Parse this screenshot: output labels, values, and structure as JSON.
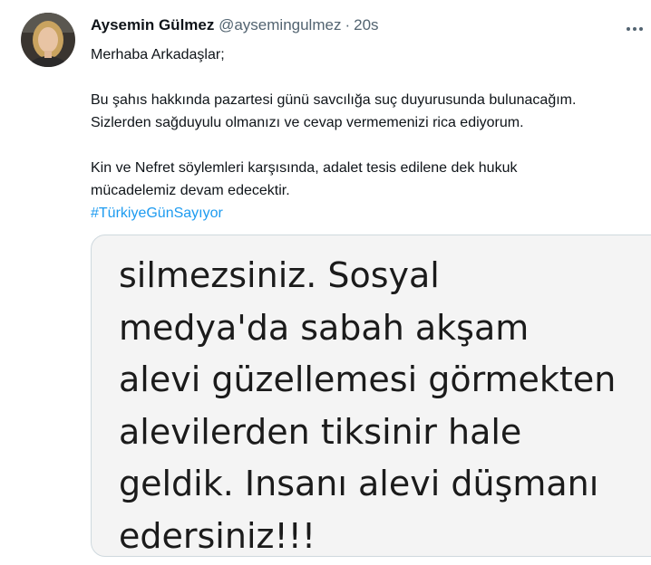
{
  "tweet": {
    "author_name": "Aysemin Gülmez",
    "handle": "@aysemingulmez",
    "separator": "·",
    "timestamp": "20s",
    "paragraph1": "Merhaba Arkadaşlar;",
    "paragraph2_line1": "Bu şahıs hakkında pazartesi günü savcılığa suç duyurusunda bulunacağım.",
    "paragraph2_line2": "Sizlerden sağduyulu olmanızı ve cevap vermemenizi rica ediyorum.",
    "paragraph3_line1": "Kin ve Nefret söylemleri karşısında, adalet tesis edilene dek hukuk",
    "paragraph3_line2": "mücadelemiz devam edecektir.",
    "hashtag": "#TürkiyeGünSayıyor",
    "hashtag_color": "#1d9bf0"
  },
  "media": {
    "lines": [
      "silmezsiniz. Sosyal",
      "medya'da sabah akşam",
      "alevi güzellemesi görmekten",
      "alevilerden tiksinir hale",
      "geldik. Insanı alevi düşmanı",
      "edersiniz!!!"
    ]
  },
  "icons": {
    "avatar": "profile-photo",
    "more": "more-options-icon"
  }
}
